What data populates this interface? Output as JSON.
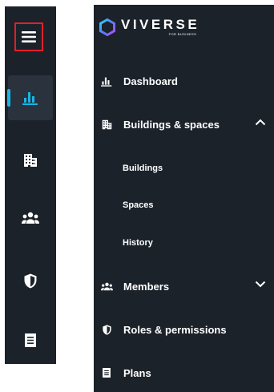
{
  "brand": {
    "name": "VIVERSE",
    "tagline": "FOR BUSINESS"
  },
  "rail": {
    "items": [
      {
        "icon": "menu-icon"
      },
      {
        "icon": "dashboard-chart-icon",
        "active": true
      },
      {
        "icon": "building-icon"
      },
      {
        "icon": "members-icon"
      },
      {
        "icon": "shield-icon"
      },
      {
        "icon": "plans-document-icon"
      }
    ]
  },
  "drawer": {
    "items": [
      {
        "label": "Dashboard",
        "icon": "dashboard-chart-icon"
      },
      {
        "label": "Buildings & spaces",
        "icon": "building-icon",
        "expanded": true
      },
      {
        "label": "Members",
        "icon": "members-icon",
        "expanded": false
      },
      {
        "label": "Roles & permissions",
        "icon": "shield-icon"
      },
      {
        "label": "Plans",
        "icon": "plans-document-icon"
      }
    ],
    "sub_items": [
      {
        "label": "Buildings"
      },
      {
        "label": "Spaces"
      },
      {
        "label": "History"
      }
    ]
  },
  "colors": {
    "background": "#1c222a",
    "accent": "#19b5e6",
    "highlight_border": "#e0202a",
    "text": "#ffffff"
  }
}
